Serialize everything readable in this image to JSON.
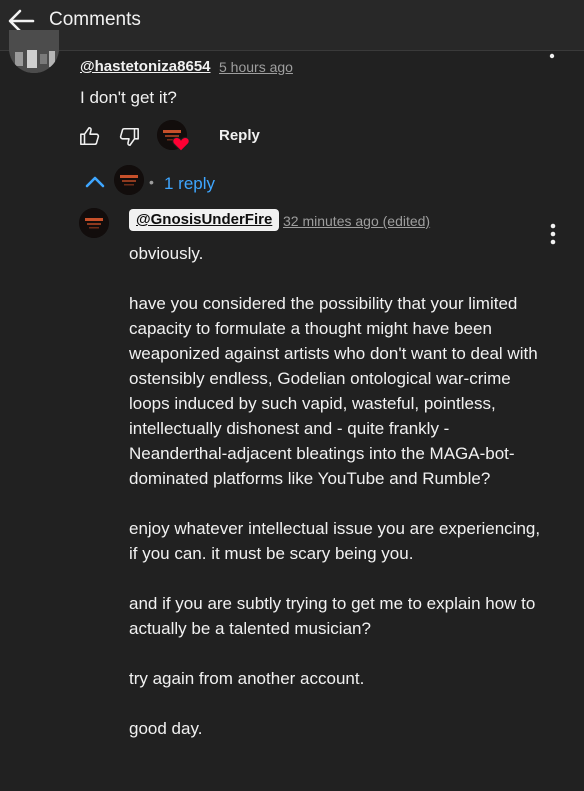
{
  "header": {
    "title": "Comments"
  },
  "comment": {
    "handle": "@hastetoniza8654",
    "time": "5 hours ago",
    "text": "I don't get it?",
    "reply_label": "Reply"
  },
  "replies_toggle": {
    "count_label": "1 reply",
    "bullet": "•"
  },
  "reply": {
    "handle": "@GnosisUnderFire",
    "time": "32 minutes ago (edited)",
    "paragraphs": [
      "obviously.",
      "have you considered the possibility that your limited capacity to formulate a thought might have been weaponized against artists who don't want to deal with ostensibly endless, Godelian ontological war-crime loops induced by such vapid, wasteful, pointless, intellectually dishonest and - quite frankly - Neanderthal-adjacent bleatings into the MAGA-bot-dominated platforms like YouTube and Rumble?",
      "enjoy whatever intellectual issue you are experiencing, if you can. it must be scary being you.",
      "and if you are subtly trying to get me to explain how to actually be a talented musician?",
      "try again from another account.",
      "good day."
    ]
  },
  "colors": {
    "background": "#212121",
    "link": "#3ea6ff",
    "heart": "#ff0033",
    "muted": "#9e9e9e"
  },
  "icons": [
    "back-arrow-icon",
    "like-icon",
    "dislike-icon",
    "heart-icon",
    "chevron-up-icon",
    "more-vert-icon"
  ]
}
